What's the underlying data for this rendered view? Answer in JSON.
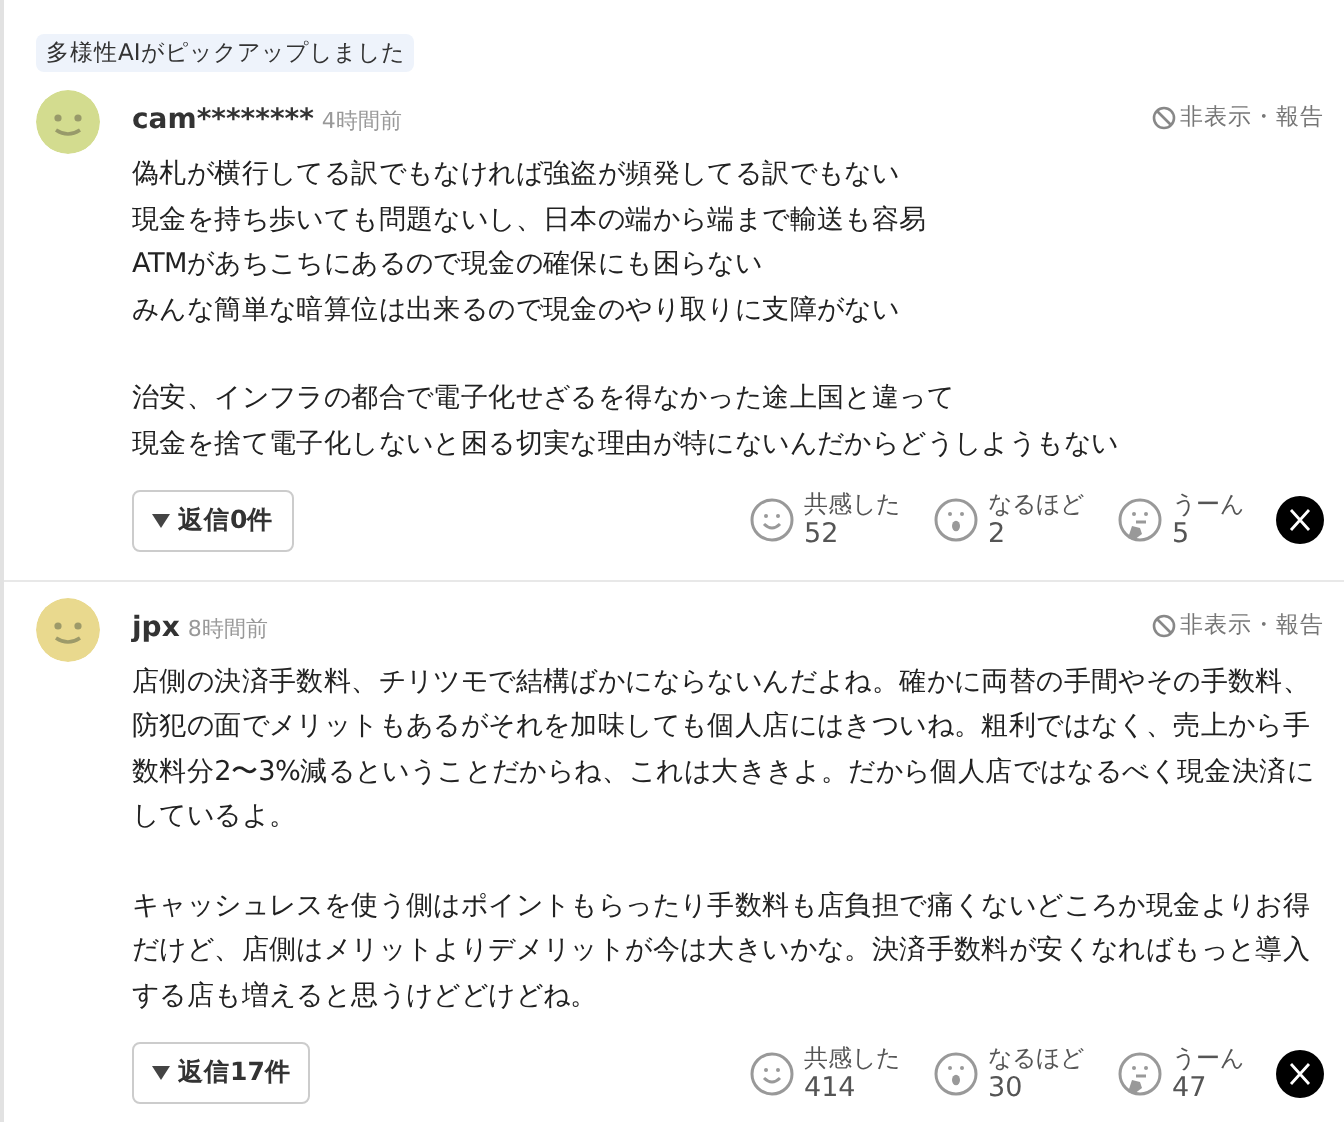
{
  "pickup_badge": "多様性AIがピックアップしました",
  "comments": [
    {
      "color": "#d3dc8f",
      "user": "cam********",
      "time": "4時間前",
      "hide_report": "非表示・報告",
      "body": [
        [
          "偽札が横行してる訳でもなければ強盗が頻発してる訳でもない",
          "現金を持ち歩いても問題ないし、日本の端から端まで輸送も容易",
          "ATMがあちこちにあるので現金の確保にも困らない",
          "みんな簡単な暗算位は出来るので現金のやり取りに支障がない"
        ],
        [
          "治安、インフラの都合で電子化せざるを得なかった途上国と違って",
          "現金を捨て電子化しないと困る切実な理由が特にないんだからどうしようもない"
        ]
      ],
      "replies": "返信0件",
      "reactions": [
        {
          "kind": "empathy",
          "label": "共感した",
          "count": "52"
        },
        {
          "kind": "insight",
          "label": "なるほど",
          "count": "2"
        },
        {
          "kind": "hmm",
          "label": "うーん",
          "count": "5"
        }
      ]
    },
    {
      "color": "#e9d98e",
      "user": "jpx",
      "time": "8時間前",
      "hide_report": "非表示・報告",
      "body": [
        [
          "店側の決済手数料、チリツモで結構ばかにならないんだよね。確かに両替の手間やその手数料、防犯の面でメリットもあるがそれを加味しても個人店にはきついね。粗利ではなく、売上から手数料分2〜3%減るということだからね、これは大ききよ。だから個人店ではなるべく現金決済にしているよ。"
        ],
        [
          "キャッシュレスを使う側はポイントもらったり手数料も店負担で痛くないどころか現金よりお得だけど、店側はメリットよりデメリットが今は大きいかな。決済手数料が安くなればもっと導入する店も増えると思うけどどけどね。"
        ]
      ],
      "replies": "返信17件",
      "reactions": [
        {
          "kind": "empathy",
          "label": "共感した",
          "count": "414"
        },
        {
          "kind": "insight",
          "label": "なるほど",
          "count": "30"
        },
        {
          "kind": "hmm",
          "label": "うーん",
          "count": "47"
        }
      ]
    }
  ]
}
